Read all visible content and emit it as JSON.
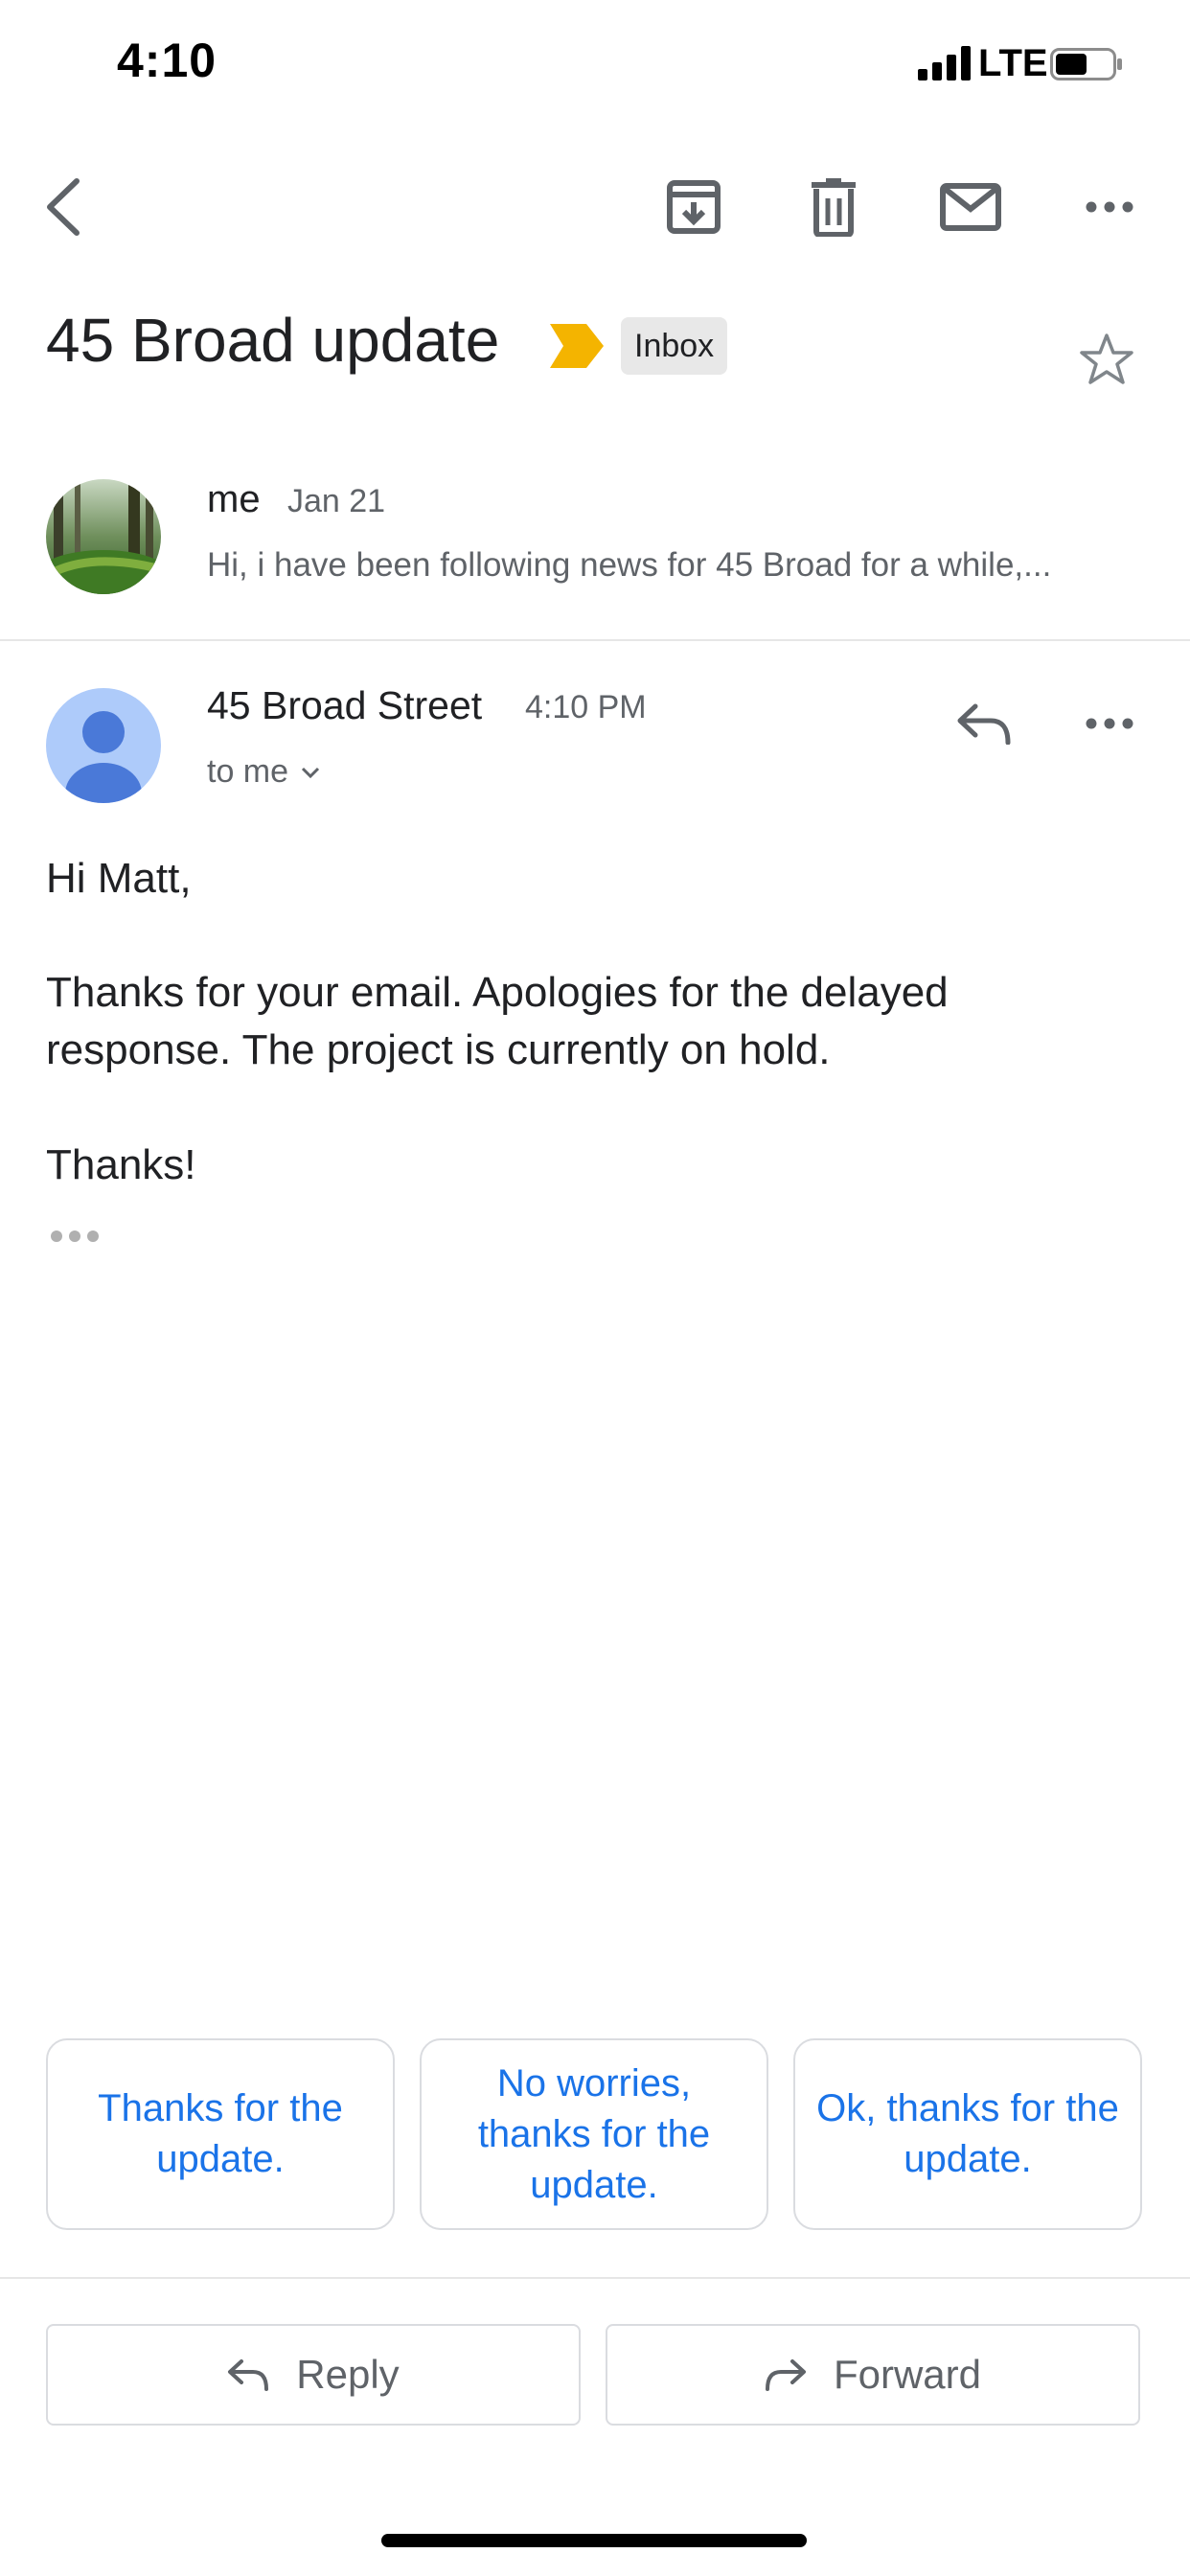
{
  "status_bar": {
    "time": "4:10",
    "network": "LTE"
  },
  "toolbar": {
    "icons": [
      "back-icon",
      "archive-icon",
      "delete-icon",
      "mark-unread-icon",
      "more-icon"
    ]
  },
  "thread": {
    "subject": "45 Broad update",
    "label": "Inbox",
    "important_color": "#F4B400"
  },
  "messages": [
    {
      "sender": "me",
      "date": "Jan 21",
      "snippet": "Hi, i have been following news for 45 Broad for a while,..."
    },
    {
      "sender": "45 Broad Street",
      "time": "4:10 PM",
      "recipient": "to me",
      "body": {
        "greeting": "Hi Matt,",
        "paragraph": "Thanks for your email. Apologies for the delayed response. The project is currently on hold.",
        "closing": "Thanks!"
      }
    }
  ],
  "smart_replies": [
    "Thanks for the update.",
    "No worries, thanks for the update.",
    "Ok, thanks for the update."
  ],
  "actions": {
    "reply": "Reply",
    "forward": "Forward"
  },
  "colors": {
    "accent": "#1A73E8",
    "avatar_bg": "#AECBFA",
    "avatar_fg": "#4A79D8"
  }
}
